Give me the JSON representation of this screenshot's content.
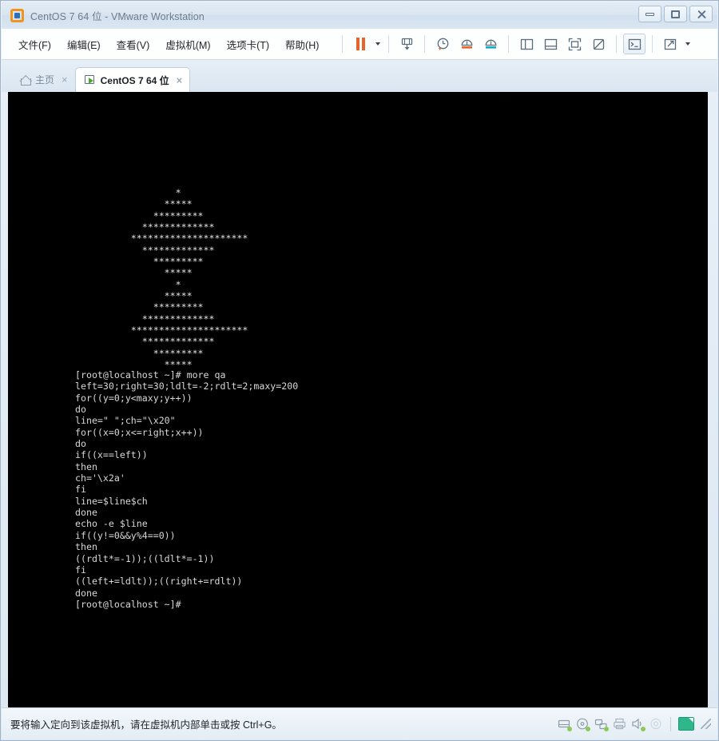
{
  "window": {
    "title": "CentOS 7 64 位 - VMware Workstation",
    "logo_icon": "vmware-logo-icon",
    "controls": [
      {
        "name": "minimize-button",
        "icon": "minimize-icon",
        "label": ""
      },
      {
        "name": "maximize-button",
        "icon": "maximize-icon",
        "label": ""
      },
      {
        "name": "close-button",
        "icon": "close-icon",
        "label": ""
      }
    ]
  },
  "menu": {
    "items": [
      {
        "label": "文件(F)"
      },
      {
        "label": "编辑(E)"
      },
      {
        "label": "查看(V)"
      },
      {
        "label": "虚拟机(M)"
      },
      {
        "label": "选项卡(T)"
      },
      {
        "label": "帮助(H)"
      }
    ]
  },
  "toolbar": {
    "buttons": [
      {
        "icon": "pause-icon",
        "label": ""
      },
      {
        "icon": "chevron-down-icon",
        "label": ""
      },
      {
        "icon": "send-ctrl-alt-del-icon",
        "label": ""
      },
      {
        "icon": "snapshot-icon",
        "label": ""
      },
      {
        "icon": "revert-snapshot-icon",
        "label": ""
      },
      {
        "icon": "snapshot-manager-icon",
        "label": ""
      },
      {
        "icon": "show-sidebar-icon",
        "label": ""
      },
      {
        "icon": "show-thumbnail-bar-icon",
        "label": ""
      },
      {
        "icon": "fullscreen-icon",
        "label": ""
      },
      {
        "icon": "unity-mode-icon",
        "label": ""
      },
      {
        "icon": "console-view-icon",
        "label": ""
      },
      {
        "icon": "expand-view-icon",
        "label": ""
      },
      {
        "icon": "chevron-down-icon",
        "label": ""
      }
    ]
  },
  "tabs": [
    {
      "label": "主页",
      "icon": "home-icon",
      "active": false,
      "close": "×"
    },
    {
      "label": "CentOS 7 64 位",
      "icon": "vm-tab-icon",
      "active": true,
      "close": "×"
    }
  ],
  "terminal": {
    "ascii_art": "                  *\n                *****\n              *********\n            *************\n          *********************\n            *************\n              *********\n                *****\n                  *\n                *****\n              *********\n            *************\n          *********************\n            *************\n              *********\n                *****",
    "log": "[root@localhost ~]# more qa\nleft=30;right=30;ldlt=-2;rdlt=2;maxy=200\nfor((y=0;y<maxy;y++))\ndo\nline=\" \";ch=\"\\x20\"\nfor((x=0;x<=right;x++))\ndo\nif((x==left))\nthen\nch='\\x2a'\nfi\nline=$line$ch\ndone\necho -e $line\nif((y!=0&&y%4==0))\nthen\n((rdlt*=-1));((ldlt*=-1))\nfi\n((left+=ldlt));((right+=rdlt))\ndone\n[root@localhost ~]#",
    "background_color": "#000000",
    "text_color": "#d8d8d8"
  },
  "status": {
    "message": "要将输入定向到该虚拟机，请在虚拟机内部单击或按 Ctrl+G。",
    "icons": [
      {
        "name": "hard-disk-icon"
      },
      {
        "name": "cd-dvd-icon"
      },
      {
        "name": "network-adapter-icon"
      },
      {
        "name": "printer-icon"
      },
      {
        "name": "sound-card-icon"
      },
      {
        "name": "usb-device-icon"
      },
      {
        "name": "display-icon"
      }
    ]
  },
  "colors": {
    "accent_orange": "#e8622a",
    "logo_blue": "#2e6fb7",
    "terminal_bg": "#000000",
    "status_green": "#7dc242"
  }
}
